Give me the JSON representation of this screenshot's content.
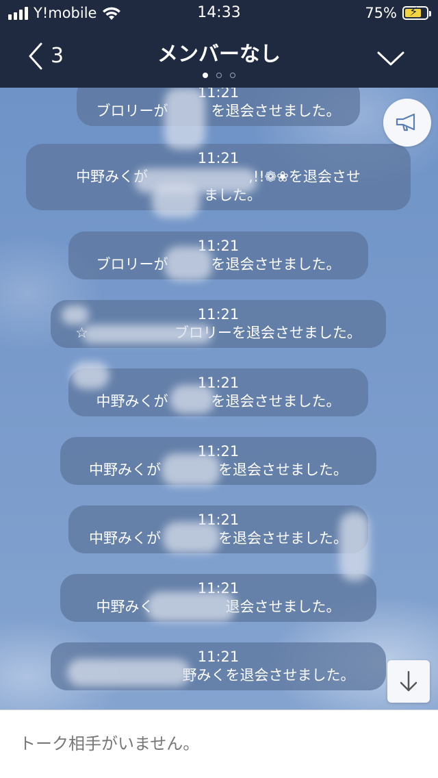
{
  "status": {
    "carrier": "Y!mobile",
    "time": "14:33",
    "battery": "75%",
    "battery_level": 0.75,
    "icons": [
      "signal-icon",
      "wifi-icon",
      "battery-charging-icon"
    ]
  },
  "header": {
    "back_count": "3",
    "title": "メンバーなし",
    "page_dots": 3,
    "active_dot": 0,
    "icons": [
      "back-chevron-icon",
      "chevron-down-icon"
    ]
  },
  "messages": [
    {
      "time": "11:21",
      "lines": [
        "ブロリーが　　　を退会させました。"
      ]
    },
    {
      "time": "11:21",
      "lines": [
        "中野みくが　　　　　　　,!!❁❀を退会させ",
        "　　ました。"
      ]
    },
    {
      "time": "11:21",
      "lines": [
        "ブロリーが　　　を退会させました。"
      ]
    },
    {
      "time": "11:21",
      "lines": [
        "☆　　　　　　ブロリーを退会させました。"
      ]
    },
    {
      "time": "11:21",
      "lines": [
        "中野みくが　　　を退会させました。"
      ]
    },
    {
      "time": "11:21",
      "lines": [
        "中野みくが　　　　を退会させました。"
      ]
    },
    {
      "time": "11:21",
      "lines": [
        "中野みくが　　　　を退会させました。"
      ]
    },
    {
      "time": "11:21",
      "lines": [
        "中野みく　　　　　退会させました。"
      ]
    },
    {
      "time": "11:21",
      "lines": [
        "　　　　　　　野みくを退会させました。"
      ]
    }
  ],
  "buttons": {
    "announcement": "megaphone-icon",
    "scroll_down": "arrow-down-icon"
  },
  "footer": {
    "placeholder": "トーク相手がいません。"
  },
  "colors": {
    "header_bg": "#1f2a40",
    "chat_bg": "#7b9cc9",
    "bubble": "#5b749b",
    "battery_charge": "#f5d442"
  }
}
